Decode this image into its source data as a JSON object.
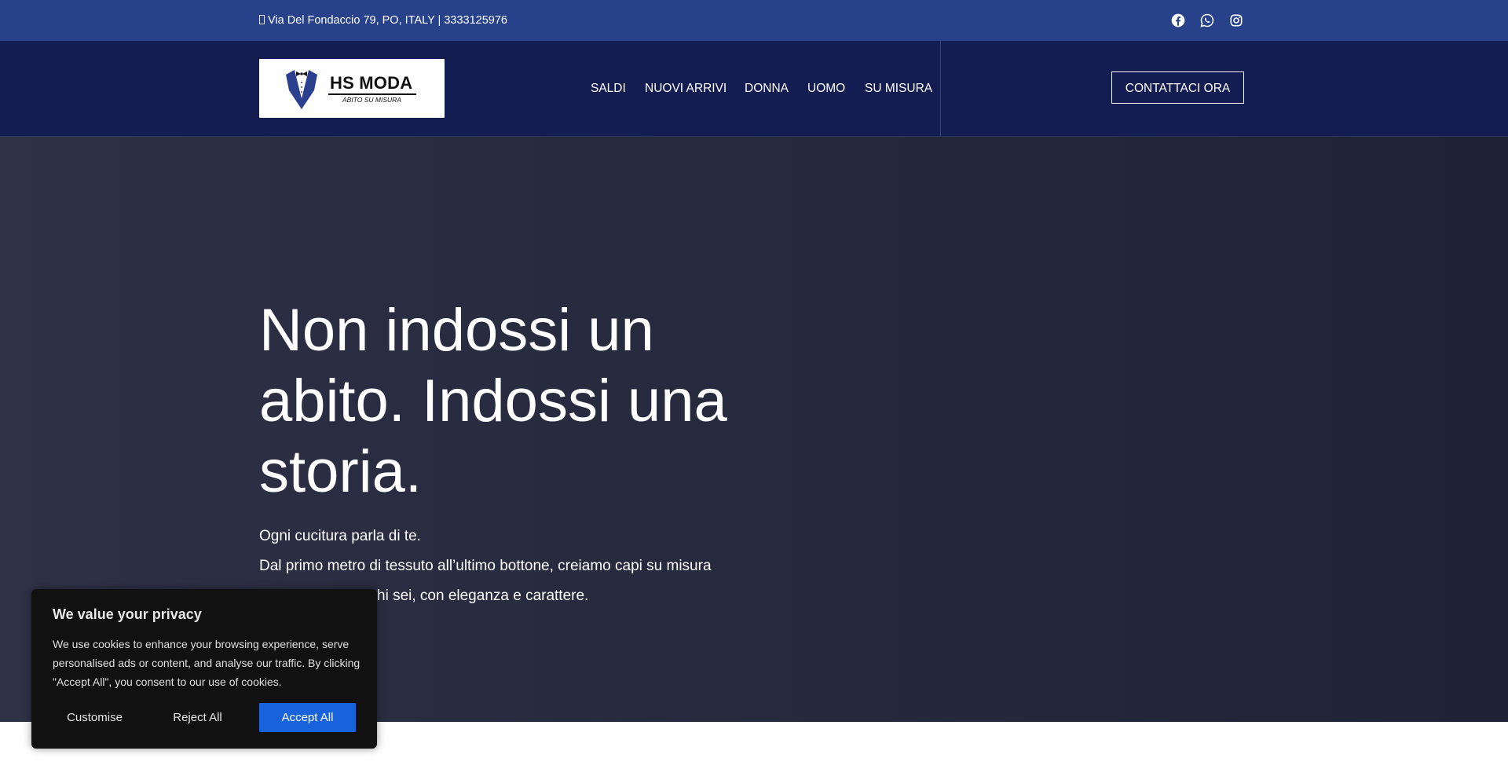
{
  "topbar": {
    "contact_text": "Via Del Fondaccio 79, PO, ITALY |  3333125976",
    "social_icons": [
      "facebook-icon",
      "whatsapp-icon",
      "instagram-icon"
    ]
  },
  "header": {
    "logo": {
      "brand": "HS MODA",
      "tagline": "ABITO SU MISURA"
    },
    "nav": [
      {
        "label": "SALDI"
      },
      {
        "label": "NUOVI ARRIVI"
      },
      {
        "label": "DONNA"
      },
      {
        "label": "UOMO"
      },
      {
        "label": "SU MISURA"
      }
    ],
    "cta_label": "CONTATTACI ORA"
  },
  "hero": {
    "title": "Non indossi un abito. Indossi una storia.",
    "line1": "Ogni cucitura parla di te.",
    "line2": "Dal primo metro di tessuto all’ultimo bottone, creiamo capi su misura",
    "line3_visible": "hi sei, con eleganza e carattere."
  },
  "cookie": {
    "title": "We value your privacy",
    "message": "We use cookies to enhance your browsing experience, serve personalised ads or content, and analyse our traffic. By clicking \"Accept All\", you consent to our use of cookies.",
    "customise_label": "Customise",
    "reject_label": "Reject All",
    "accept_label": "Accept All"
  },
  "colors": {
    "topbar": "#27428b",
    "header": "#131d52",
    "hero": "#292c40",
    "accept_button": "#1863dc",
    "cookie_banner": "#111111"
  }
}
